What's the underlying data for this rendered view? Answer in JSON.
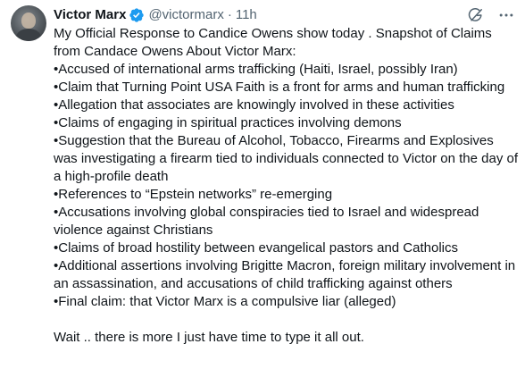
{
  "author": {
    "name": "Victor Marx",
    "handle": "@victormarx",
    "time": "11h",
    "separator": "·"
  },
  "icons": {
    "verified": "verified-badge-icon",
    "grok": "grok-icon",
    "more": "more-options-icon"
  },
  "colors": {
    "verified_blue": "#1d9bf0",
    "secondary_text": "#536471",
    "primary_text": "#0f1419"
  },
  "tweet": {
    "lines": [
      "My Official Response to Candice Owens show today .  Snapshot of Claims from Candace Owens About Victor Marx:",
      "•Accused of international arms trafficking (Haiti, Israel, possibly Iran)",
      "•Claim that Turning Point USA Faith is a front for arms and human trafficking",
      "•Allegation that associates are knowingly involved in these activities",
      "•Claims of engaging in spiritual practices involving demons",
      "•Suggestion that the Bureau of Alcohol, Tobacco, Firearms and Explosives was investigating a firearm tied to individuals connected to Victor on the day of a high-profile death",
      "•References to “Epstein networks” re-emerging",
      "•Accusations involving global conspiracies tied to Israel and widespread violence against Christians",
      "•Claims of broad hostility between evangelical pastors and Catholics",
      "•Additional assertions involving Brigitte Macron, foreign military involvement in an assassination, and accusations of child trafficking against others",
      "•Final claim: that Victor Marx is a compulsive liar (alleged)"
    ],
    "closing": "Wait .. there is more I just have time to type it all out."
  }
}
